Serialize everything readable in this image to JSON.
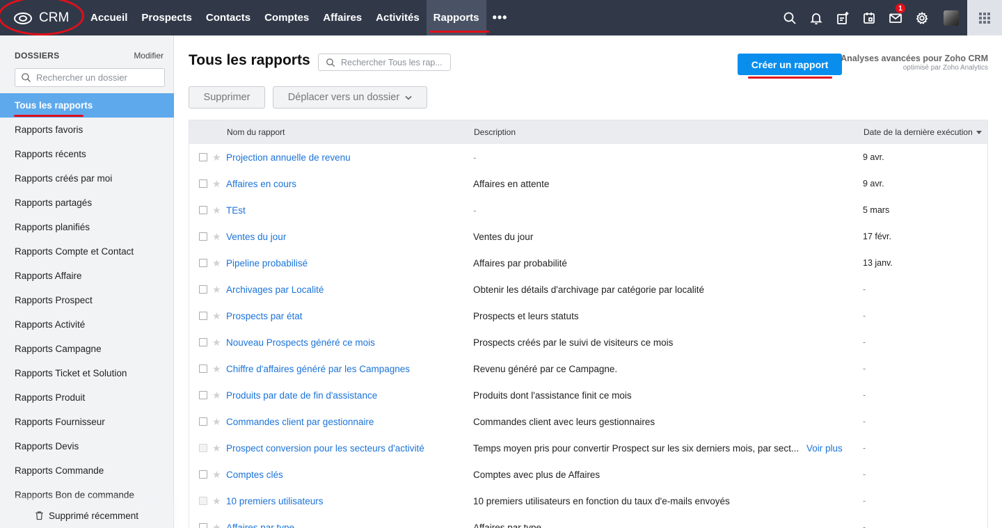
{
  "app": {
    "name": "CRM"
  },
  "nav": {
    "items": [
      {
        "label": "Accueil",
        "key": "accueil"
      },
      {
        "label": "Prospects",
        "key": "prospects"
      },
      {
        "label": "Contacts",
        "key": "contacts"
      },
      {
        "label": "Comptes",
        "key": "comptes"
      },
      {
        "label": "Affaires",
        "key": "affaires"
      },
      {
        "label": "Activités",
        "key": "activites"
      },
      {
        "label": "Rapports",
        "key": "rapports"
      }
    ],
    "active": "Rapports",
    "more": "•••",
    "mail_badge": "1"
  },
  "sidebar": {
    "title": "DOSSIERS",
    "edit": "Modifier",
    "search_placeholder": "Rechercher un dossier",
    "items": [
      "Tous les rapports",
      "Rapports favoris",
      "Rapports récents",
      "Rapports créés par moi",
      "Rapports partagés",
      "Rapports planifiés",
      "Rapports Compte et Contact",
      "Rapports Affaire",
      "Rapports Prospect",
      "Rapports Activité",
      "Rapports Campagne",
      "Rapports Ticket et Solution",
      "Rapports Produit",
      "Rapports Fournisseur",
      "Rapports Devis",
      "Rapports Commande",
      "Rapports Bon de commande"
    ],
    "footer": "Supprimé récemment"
  },
  "main": {
    "title": "Tous les rapports",
    "search_placeholder": "Rechercher Tous les rap...",
    "create_button": "Créer un rapport",
    "analytics_title": "Analyses avancées pour Zoho CRM",
    "analytics_sub": "optimisé par Zoho Analytics",
    "delete_button": "Supprimer",
    "move_button": "Déplacer vers un dossier"
  },
  "table": {
    "columns": {
      "name": "Nom du rapport",
      "description": "Description",
      "date": "Date de la dernière exécution"
    },
    "rows": [
      {
        "name": "Projection annuelle de revenu",
        "description": "-",
        "date": "9 avr."
      },
      {
        "name": "Affaires en cours",
        "description": "Affaires en attente",
        "date": "9 avr."
      },
      {
        "name": "TEst",
        "description": "-",
        "date": "5 mars"
      },
      {
        "name": "Ventes du jour",
        "description": "Ventes du jour",
        "date": "17 févr."
      },
      {
        "name": "Pipeline probabilisé",
        "description": "Affaires par probabilité",
        "date": "13 janv."
      },
      {
        "name": "Archivages par Localité",
        "description": "Obtenir les détails d'archivage par catégorie par localité",
        "date": "-"
      },
      {
        "name": "Prospects par état",
        "description": "Prospects et leurs statuts",
        "date": "-"
      },
      {
        "name": "Nouveau Prospects généré ce mois",
        "description": "Prospects créés par le suivi de visiteurs ce mois",
        "date": "-"
      },
      {
        "name": "Chiffre d'affaires généré par les Campagnes",
        "description": "Revenu généré par ce Campagne.",
        "date": "-"
      },
      {
        "name": "Produits par date de fin d'assistance",
        "description": "Produits dont l'assistance finit ce mois",
        "date": "-"
      },
      {
        "name": "Commandes client par gestionnaire",
        "description": "Commandes client avec leurs gestionnaires",
        "date": "-"
      },
      {
        "name": "Prospect conversion pour les secteurs d'activité",
        "description": "Temps moyen pris pour convertir Prospect sur les six derniers mois, par sect...",
        "date": "-",
        "more": "Voir plus"
      },
      {
        "name": "Comptes clés",
        "description": "Comptes avec plus de Affaires",
        "date": "-"
      },
      {
        "name": "10 premiers utilisateurs",
        "description": "10 premiers utilisateurs en fonction du taux d'e-mails envoyés",
        "date": "-"
      },
      {
        "name": "Affaires par type",
        "description": "Affaires par type",
        "date": "-"
      }
    ]
  }
}
